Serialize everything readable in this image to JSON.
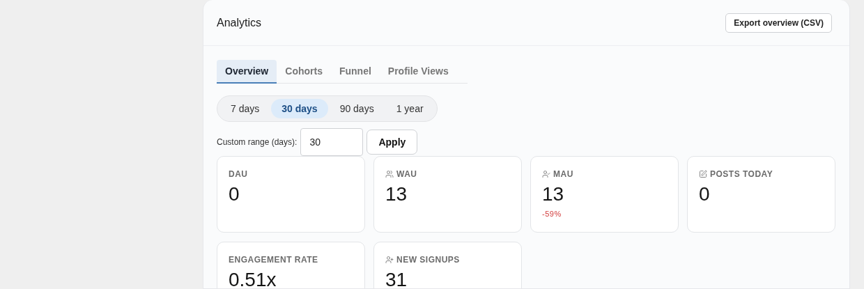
{
  "panel": {
    "title": "Analytics",
    "export_button": "Export overview (CSV)"
  },
  "tabs": [
    {
      "label": "Overview",
      "selected": true
    },
    {
      "label": "Cohorts",
      "selected": false
    },
    {
      "label": "Funnel",
      "selected": false
    },
    {
      "label": "Profile Views",
      "selected": false
    }
  ],
  "ranges": [
    {
      "label": "7 days",
      "selected": false
    },
    {
      "label": "30 days",
      "selected": true
    },
    {
      "label": "90 days",
      "selected": false
    },
    {
      "label": "1 year",
      "selected": false
    }
  ],
  "custom_range": {
    "label": "Custom range (days):",
    "value": "30",
    "button": "Apply"
  },
  "metrics": [
    {
      "label": "DAU",
      "value": "0",
      "kind": "plain"
    },
    {
      "label": "WAU",
      "value": "13",
      "kind": "users"
    },
    {
      "label": "MAU",
      "value": "13",
      "kind": "monthly",
      "delta": "-59%"
    },
    {
      "label": "POSTS TODAY",
      "value": "0",
      "kind": "posts"
    },
    {
      "label": "ENGAGEMENT RATE",
      "value": "0.51x",
      "kind": "plain"
    },
    {
      "label": "NEW SIGNUPS",
      "value": "31",
      "kind": "signups"
    }
  ]
}
